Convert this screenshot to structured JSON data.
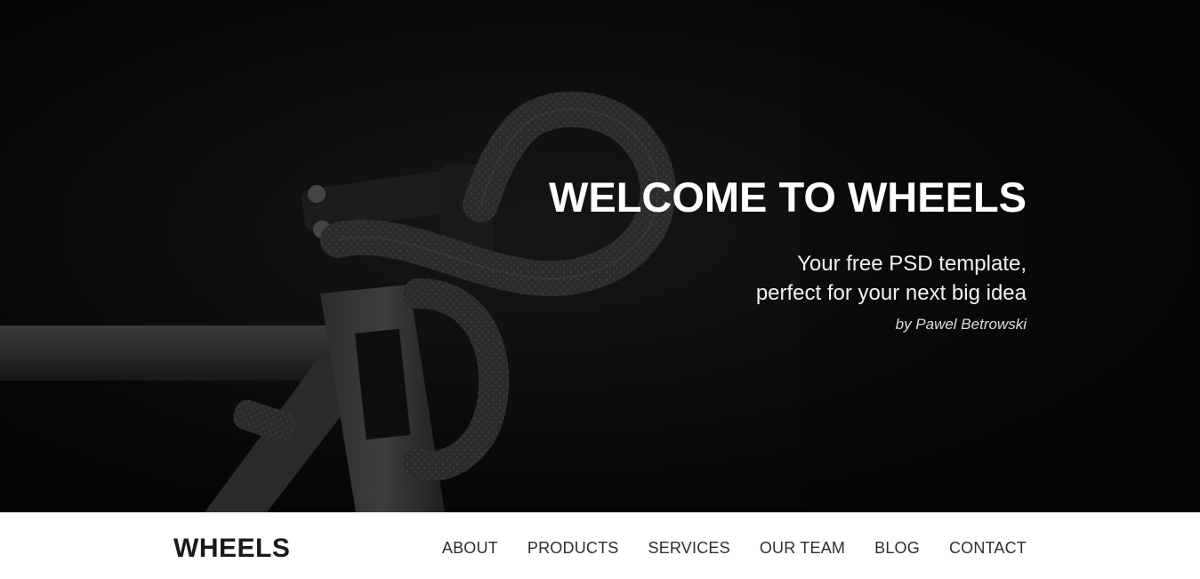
{
  "hero": {
    "title": "WELCOME TO WHEELS",
    "subtitle_line1": "Your free PSD template,",
    "subtitle_line2": "perfect for your next big idea",
    "author": "by Pawel Betrowski",
    "image": "bicycle-handlebar-photo",
    "background_color": "#0b0b0b"
  },
  "navbar": {
    "brand": "WHEELS",
    "links": [
      {
        "label": "ABOUT"
      },
      {
        "label": "PRODUCTS"
      },
      {
        "label": "SERVICES"
      },
      {
        "label": "OUR TEAM"
      },
      {
        "label": "BLOG"
      },
      {
        "label": "CONTACT"
      }
    ]
  }
}
